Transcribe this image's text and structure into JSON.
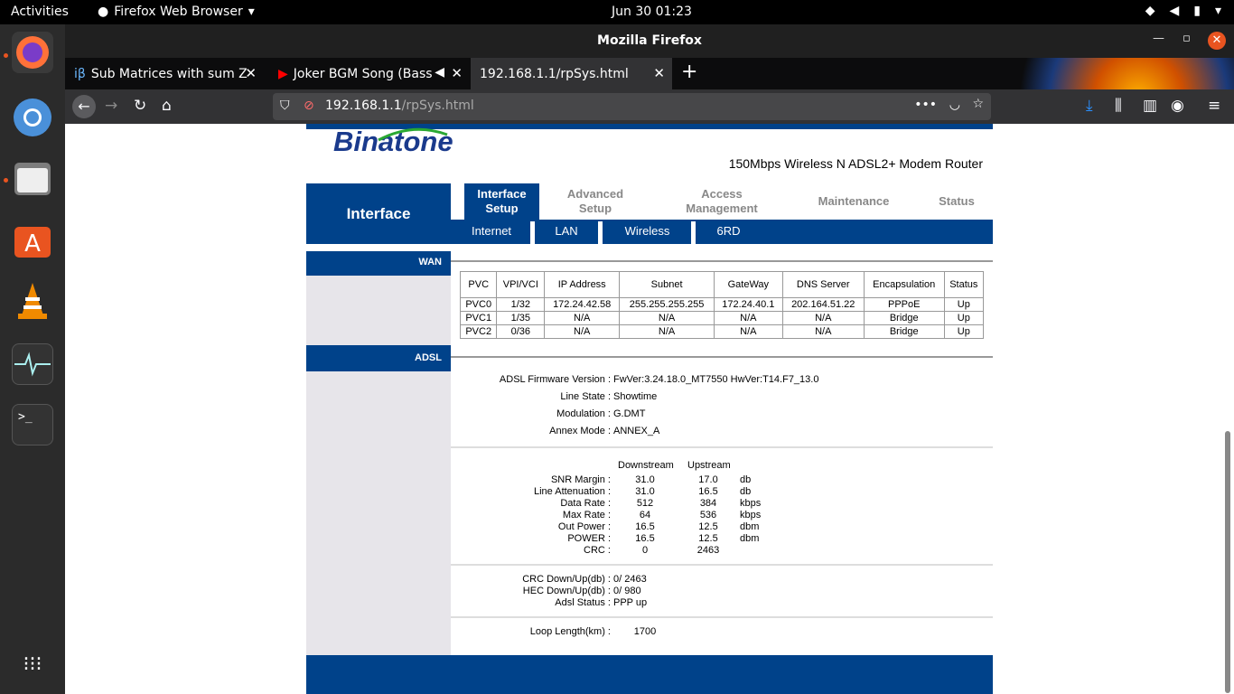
{
  "topbar": {
    "activities": "Activities",
    "app": "Firefox Web Browser",
    "clock": "Jun 30  01:23"
  },
  "window": {
    "title": "Mozilla Firefox"
  },
  "tabs": [
    {
      "label": "Sub Matrices with sum Z"
    },
    {
      "label": "Joker BGM Song (Bass"
    },
    {
      "label": "192.168.1.1/rpSys.html"
    }
  ],
  "url": {
    "host": "192.168.1.1",
    "path": "/rpSys.html"
  },
  "router": {
    "brand": "Binatone",
    "product": "150Mbps Wireless N ADSL2+ Modem Router",
    "section": "Interface",
    "menu": [
      {
        "l1": "Interface",
        "l2": "Setup"
      },
      {
        "l1": "Advanced",
        "l2": "Setup"
      },
      {
        "l1": "Access",
        "l2": "Management"
      },
      {
        "l1": "Maintenance",
        "l2": ""
      },
      {
        "l1": "Status",
        "l2": ""
      }
    ],
    "submenu": [
      "Internet",
      "LAN",
      "Wireless",
      "6RD"
    ],
    "wan_label": "WAN",
    "adsl_label": "ADSL",
    "wan_headers": [
      "PVC",
      "VPI/VCI",
      "IP Address",
      "Subnet",
      "GateWay",
      "DNS Server",
      "Encapsulation",
      "Status"
    ],
    "wan_rows": [
      [
        "PVC0",
        "1/32",
        "172.24.42.58",
        "255.255.255.255",
        "172.24.40.1",
        "202.164.51.22",
        "PPPoE",
        "Up"
      ],
      [
        "PVC1",
        "1/35",
        "N/A",
        "N/A",
        "N/A",
        "N/A",
        "Bridge",
        "Up"
      ],
      [
        "PVC2",
        "0/36",
        "N/A",
        "N/A",
        "N/A",
        "N/A",
        "Bridge",
        "Up"
      ]
    ],
    "adsl_info": [
      {
        "label": "ADSL Firmware Version :",
        "value": "FwVer:3.24.18.0_MT7550 HwVer:T14.F7_13.0"
      },
      {
        "label": "Line State :",
        "value": "Showtime"
      },
      {
        "label": "Modulation :",
        "value": "G.DMT"
      },
      {
        "label": "Annex Mode :",
        "value": "ANNEX_A"
      }
    ],
    "stats_headers": {
      "down": "Downstream",
      "up": "Upstream"
    },
    "stats": [
      {
        "label": "SNR Margin :",
        "down": "31.0",
        "up": "17.0",
        "unit": "db"
      },
      {
        "label": "Line Attenuation :",
        "down": "31.0",
        "up": "16.5",
        "unit": "db"
      },
      {
        "label": "Data Rate :",
        "down": "512",
        "up": "384",
        "unit": "kbps"
      },
      {
        "label": "Max Rate :",
        "down": "64",
        "up": "536",
        "unit": "kbps"
      },
      {
        "label": "Out Power :",
        "down": "16.5",
        "up": "12.5",
        "unit": "dbm"
      },
      {
        "label": "POWER :",
        "down": "16.5",
        "up": "12.5",
        "unit": "dbm"
      },
      {
        "label": "CRC :",
        "down": "0",
        "up": "2463",
        "unit": ""
      }
    ],
    "errors": [
      {
        "label": "CRC Down/Up(db) :",
        "value": "0/ 2463"
      },
      {
        "label": "HEC Down/Up(db) :",
        "value": "0/ 980"
      },
      {
        "label": "Adsl Status :",
        "value": "PPP up"
      }
    ],
    "loop": {
      "label": "Loop Length(km) :",
      "value": "1700"
    }
  }
}
